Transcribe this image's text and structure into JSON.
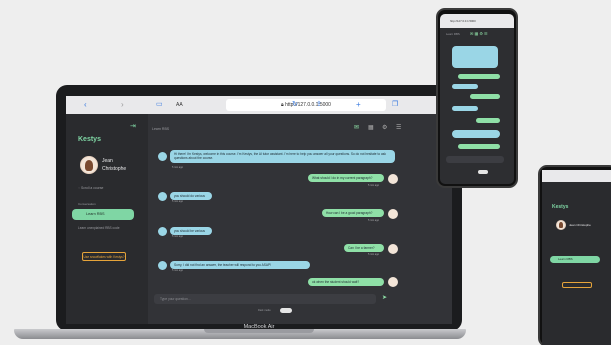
{
  "laptop": {
    "model_label": "MacBook Air",
    "toolbar": {
      "text_size": "AA",
      "url": "http://127.0.0.1:5000"
    },
    "app": {
      "brand": "Kestys",
      "user_name_line1": "Jean",
      "user_name_line2": "Christophe",
      "nav_item_1": "Scroll a course",
      "section_label": "Conversation",
      "active_chat": "Learn RBS",
      "nav_item_2": "Learn unexplained RBS code",
      "donate_label": "Use snowflakes with Kestys?",
      "chat_header": "Learn RBS",
      "input_placeholder": "Type your question...",
      "footer_toggle_label": "Dark mode",
      "messages": [
        {
          "from": "bot",
          "text": "Hi there! I'm Kestys, welcome in this course. I'm Kestys, the AI tutor assistant. I'm here to help you answer all your questions. So do not hesitate to ask questions about the course.",
          "time": "5 min ago"
        },
        {
          "from": "user",
          "text": "What should I do in my current paragraph?",
          "time": "5 min ago"
        },
        {
          "from": "bot",
          "text": "you should do various",
          "time": "5 min ago"
        },
        {
          "from": "user",
          "text": "How can I be a good paragraph?",
          "time": "5 min ago"
        },
        {
          "from": "bot",
          "text": "you should be various",
          "time": "5 min ago"
        },
        {
          "from": "user",
          "text": "Can I be a farmer?",
          "time": "5 min ago"
        },
        {
          "from": "bot",
          "text": "Sorry, I did not find an answer, the teacher will respond to you ASAP!",
          "time": "5 min ago"
        },
        {
          "from": "user",
          "text": "ok when the student should wait?",
          "time": "5 min ago"
        }
      ]
    }
  },
  "phone": {
    "url": "http://127.0.0.1:5000",
    "chat_header": "Learn RBS"
  },
  "phone2": {
    "brand": "Kestys",
    "user_name": "Jean Christophe",
    "active_chat": "Learn RBS"
  },
  "colors": {
    "accent_green": "#7fd6a4",
    "bot_bubble": "#9ad6e6",
    "user_bubble": "#8fe0a7",
    "panel_dark": "#2d2e31"
  }
}
